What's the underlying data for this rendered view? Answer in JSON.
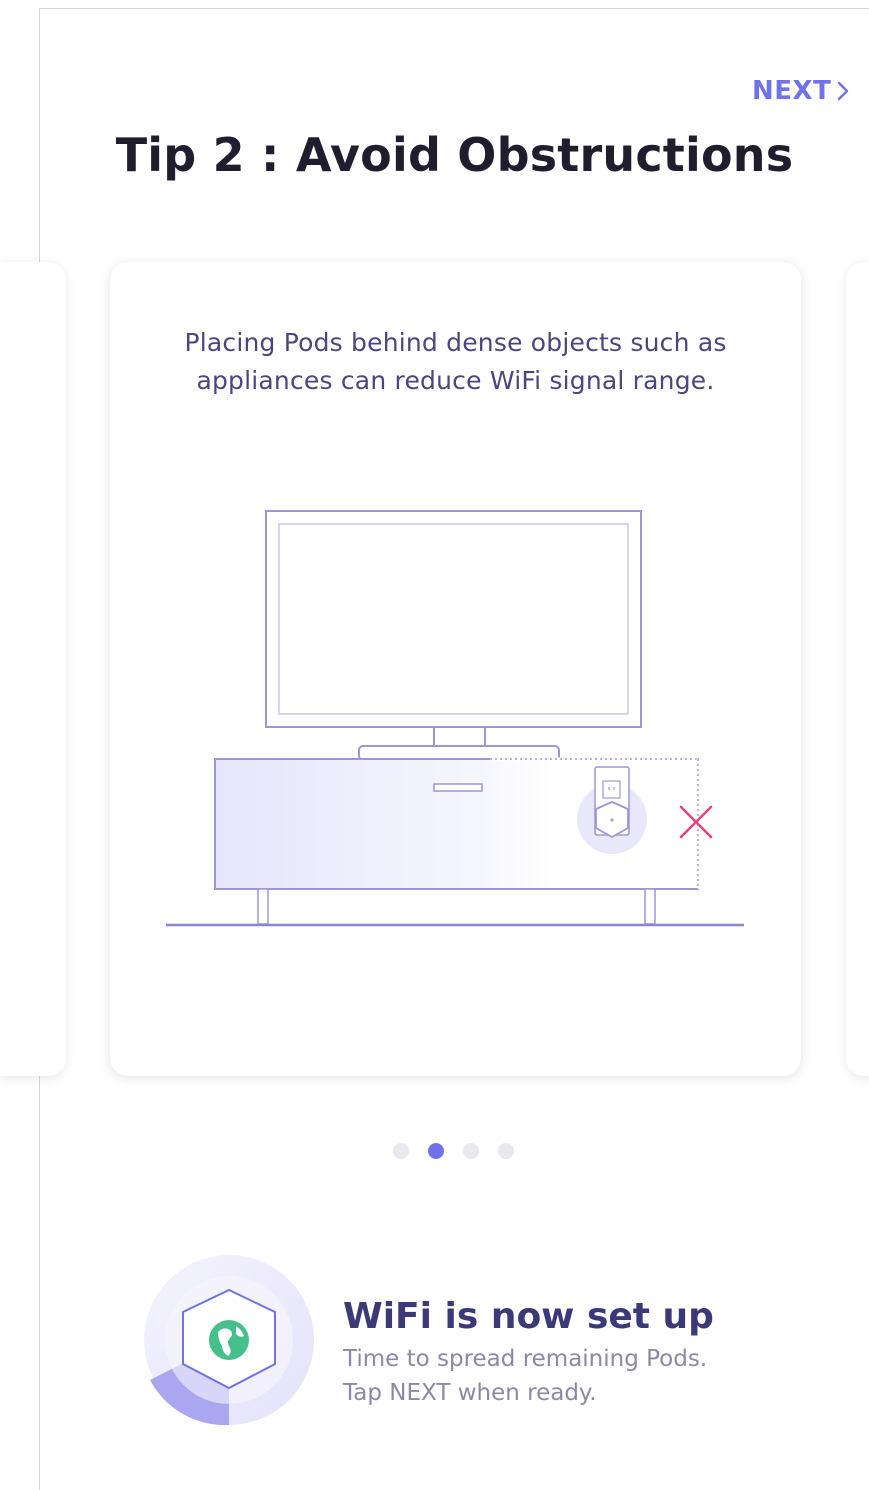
{
  "header": {
    "next_label": "NEXT",
    "title": "Tip 2 : Avoid Obstructions"
  },
  "tip_card": {
    "description": "Placing Pods behind dense objects such as appliances can reduce WiFi signal range."
  },
  "pagination": {
    "total": 4,
    "current": 2
  },
  "status": {
    "title": "WiFi is now set up",
    "line1": "Time to spread remaining Pods.",
    "line2": "Tap NEXT when ready."
  },
  "icons": {
    "next": "chevron-right-icon",
    "illustration": "tv-on-cabinet-with-pod-illustration",
    "obstruction_mark": "x-mark-icon",
    "status": "pod-with-globe-icon"
  },
  "colors": {
    "accent": "#6f72e8",
    "title": "#1f1d2e",
    "illustration_line": "#9a98d8",
    "error_mark": "#e0457b",
    "globe": "#45c08a"
  }
}
